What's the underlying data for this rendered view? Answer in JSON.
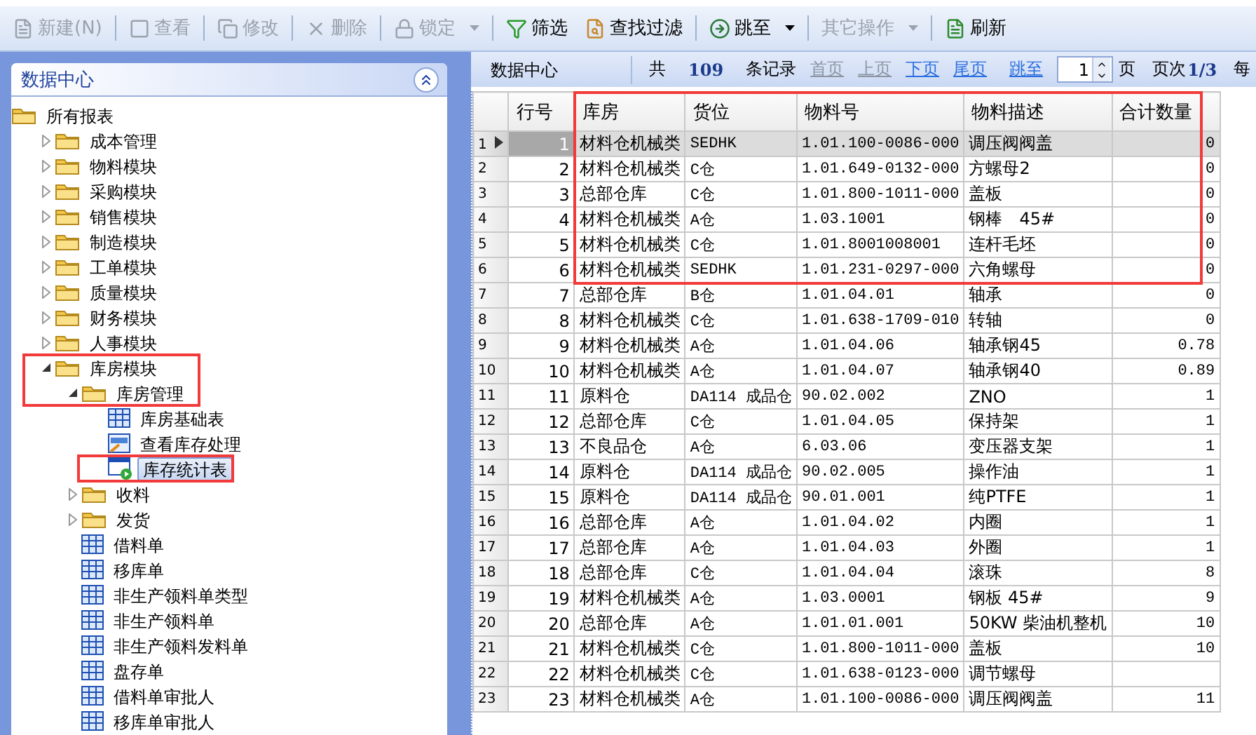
{
  "toolbar": [
    {
      "label": "新建(N)",
      "disabled": true,
      "dropdown": false
    },
    {
      "label": "查看",
      "disabled": true,
      "dropdown": false
    },
    {
      "label": "修改",
      "disabled": true,
      "dropdown": false
    },
    {
      "label": "删除",
      "disabled": true,
      "dropdown": false
    },
    {
      "label": "锁定",
      "disabled": true,
      "dropdown": true
    },
    {
      "label": "筛选",
      "disabled": false,
      "dropdown": false
    },
    {
      "label": "查找过滤",
      "disabled": false,
      "dropdown": false
    },
    {
      "label": "跳至",
      "disabled": false,
      "dropdown": true
    },
    {
      "label": "其它操作",
      "disabled": true,
      "dropdown": true
    },
    {
      "label": "刷新",
      "disabled": false,
      "dropdown": false
    }
  ],
  "annotations": [
    {
      "kind": "frame"
    },
    {
      "kind": "frame"
    },
    {
      "kind": "frame"
    }
  ],
  "sidebar": {
    "title": "数据中心",
    "tree": [
      {
        "label": "所有报表",
        "kind": "folder",
        "selected": false,
        "children": [
          {
            "label": "成本管理",
            "kind": "folder",
            "expanded": false,
            "selected": false
          },
          {
            "label": "物料模块",
            "kind": "folder",
            "expanded": false,
            "selected": false
          },
          {
            "label": "采购模块",
            "kind": "folder",
            "expanded": false,
            "selected": false
          },
          {
            "label": "销售模块",
            "kind": "folder",
            "expanded": false,
            "selected": false
          },
          {
            "label": "制造模块",
            "kind": "folder",
            "expanded": false,
            "selected": false
          },
          {
            "label": "工单模块",
            "kind": "folder",
            "expanded": false,
            "selected": false
          },
          {
            "label": "质量模块",
            "kind": "folder",
            "expanded": false,
            "selected": false
          },
          {
            "label": "财务模块",
            "kind": "folder",
            "expanded": false,
            "selected": false
          },
          {
            "label": "人事模块",
            "kind": "folder",
            "expanded": false,
            "selected": false
          },
          {
            "label": "库房模块",
            "kind": "folder",
            "expanded": true,
            "selected": false,
            "children": [
              {
                "label": "库房管理",
                "kind": "folder",
                "expanded": true,
                "selected": false,
                "children": [
                  {
                    "label": "库房基础表",
                    "kind": "table",
                    "selected": false
                  },
                  {
                    "label": "查看库存处理",
                    "kind": "view",
                    "selected": false
                  },
                  {
                    "label": "库存统计表",
                    "kind": "report",
                    "selected": true
                  }
                ]
              },
              {
                "label": "收料",
                "kind": "folder",
                "expanded": false,
                "selected": false
              },
              {
                "label": "发货",
                "kind": "folder",
                "expanded": false,
                "selected": false
              },
              {
                "label": "借料单",
                "kind": "table",
                "selected": false
              },
              {
                "label": "移库单",
                "kind": "table",
                "selected": false
              },
              {
                "label": "非生产领料单类型",
                "kind": "table",
                "selected": false
              },
              {
                "label": "非生产领料单",
                "kind": "table",
                "selected": false
              },
              {
                "label": "非生产领料发料单",
                "kind": "table",
                "selected": false
              },
              {
                "label": "盘存单",
                "kind": "table",
                "selected": false
              },
              {
                "label": "借料单审批人",
                "kind": "table",
                "selected": false
              },
              {
                "label": "移库单审批人",
                "kind": "table",
                "selected": false
              }
            ]
          }
        ]
      }
    ]
  },
  "pager": {
    "title": "数据中心",
    "total_prefix": "共",
    "total": "109",
    "total_suffix": "条记录",
    "links": [
      {
        "label": "首页",
        "disabled": true
      },
      {
        "label": "上页",
        "disabled": true
      },
      {
        "label": "下页",
        "disabled": false
      },
      {
        "label": "尾页",
        "disabled": false
      },
      {
        "label": "跳至",
        "disabled": false
      }
    ],
    "page_value": "1",
    "page_label": "页",
    "page_info_label": "页次",
    "page_info": "1/3",
    "per_page_label": "每"
  },
  "table": {
    "columns": [
      "行号",
      "库房",
      "货位",
      "物料号",
      "物料描述",
      "合计数量"
    ],
    "rows": [
      {
        "index": "1",
        "cells": [
          "1",
          "材料仓机械类",
          "SEDHK",
          "1.01.100-0086-000",
          "调压阀阀盖",
          "0"
        ],
        "selected": true
      },
      {
        "index": "2",
        "cells": [
          "2",
          "材料仓机械类",
          "C仓",
          "1.01.649-0132-000",
          "方螺母2",
          "0"
        ],
        "selected": false
      },
      {
        "index": "3",
        "cells": [
          "3",
          "总部仓库",
          "C仓",
          "1.01.800-1011-000",
          "盖板",
          "0"
        ],
        "selected": false
      },
      {
        "index": "4",
        "cells": [
          "4",
          "材料仓机械类",
          "A仓",
          "1.03.1001",
          "钢棒　45#",
          "0"
        ],
        "selected": false
      },
      {
        "index": "5",
        "cells": [
          "5",
          "材料仓机械类",
          "C仓",
          "1.01.8001008001",
          "连杆毛坯",
          "0"
        ],
        "selected": false
      },
      {
        "index": "6",
        "cells": [
          "6",
          "材料仓机械类",
          "SEDHK",
          "1.01.231-0297-000",
          "六角螺母",
          "0"
        ],
        "selected": false
      },
      {
        "index": "7",
        "cells": [
          "7",
          "总部仓库",
          "B仓",
          "1.01.04.01",
          "轴承",
          "0"
        ],
        "selected": false
      },
      {
        "index": "8",
        "cells": [
          "8",
          "材料仓机械类",
          "C仓",
          "1.01.638-1709-010",
          "转轴",
          "0"
        ],
        "selected": false
      },
      {
        "index": "9",
        "cells": [
          "9",
          "材料仓机械类",
          "A仓",
          "1.01.04.06",
          "轴承钢45",
          "0.78"
        ],
        "selected": false
      },
      {
        "index": "10",
        "cells": [
          "10",
          "材料仓机械类",
          "A仓",
          "1.01.04.07",
          "轴承钢40",
          "0.89"
        ],
        "selected": false
      },
      {
        "index": "11",
        "cells": [
          "11",
          "原料仓",
          "DA114 成品仓",
          "90.02.002",
          "ZNO",
          "1"
        ],
        "selected": false
      },
      {
        "index": "12",
        "cells": [
          "12",
          "总部仓库",
          "C仓",
          "1.01.04.05",
          "保持架",
          "1"
        ],
        "selected": false
      },
      {
        "index": "13",
        "cells": [
          "13",
          "不良品仓",
          "A仓",
          "6.03.06",
          "变压器支架",
          "1"
        ],
        "selected": false
      },
      {
        "index": "14",
        "cells": [
          "14",
          "原料仓",
          "DA114 成品仓",
          "90.02.005",
          "操作油",
          "1"
        ],
        "selected": false
      },
      {
        "index": "15",
        "cells": [
          "15",
          "原料仓",
          "DA114 成品仓",
          "90.01.001",
          "纯PTFE",
          "1"
        ],
        "selected": false
      },
      {
        "index": "16",
        "cells": [
          "16",
          "总部仓库",
          "A仓",
          "1.01.04.02",
          "内圈",
          "1"
        ],
        "selected": false
      },
      {
        "index": "17",
        "cells": [
          "17",
          "总部仓库",
          "A仓",
          "1.01.04.03",
          "外圈",
          "1"
        ],
        "selected": false
      },
      {
        "index": "18",
        "cells": [
          "18",
          "总部仓库",
          "C仓",
          "1.01.04.04",
          "滚珠",
          "8"
        ],
        "selected": false
      },
      {
        "index": "19",
        "cells": [
          "19",
          "材料仓机械类",
          "A仓",
          "1.03.0001",
          "钢板 45#",
          "9"
        ],
        "selected": false
      },
      {
        "index": "20",
        "cells": [
          "20",
          "总部仓库",
          "A仓",
          "1.01.01.001",
          "50KW 柴油机整机",
          "10"
        ],
        "selected": false
      },
      {
        "index": "21",
        "cells": [
          "21",
          "材料仓机械类",
          "C仓",
          "1.01.800-1011-000",
          "盖板",
          "10"
        ],
        "selected": false
      },
      {
        "index": "22",
        "cells": [
          "22",
          "材料仓机械类",
          "C仓",
          "1.01.638-0123-000",
          "调节螺母"
        ],
        "selected": false
      },
      {
        "index": "23",
        "cells": [
          "23",
          "材料仓机械类",
          "A仓",
          "1.01.100-0086-000",
          "调压阀阀盖",
          "11"
        ],
        "selected": false
      }
    ]
  }
}
